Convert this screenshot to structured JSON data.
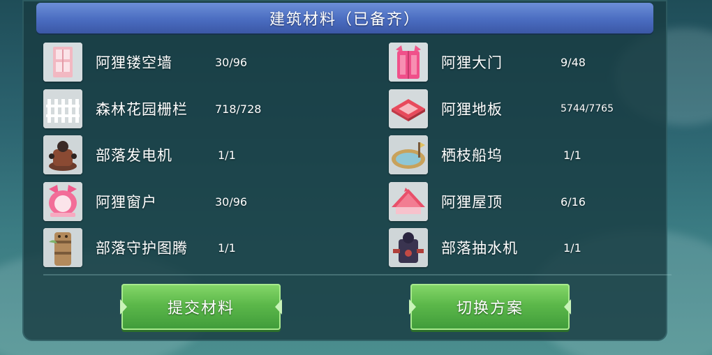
{
  "header": {
    "title": "建筑材料（已备齐）"
  },
  "left_items": [
    {
      "name": "阿狸镂空墙",
      "count": "30/96",
      "icon": "hollow-wall-icon"
    },
    {
      "name": "森林花园栅栏",
      "count": "718/728",
      "icon": "fence-icon"
    },
    {
      "name": "部落发电机",
      "count": "1/1",
      "icon": "generator-icon"
    },
    {
      "name": "阿狸窗户",
      "count": "30/96",
      "icon": "window-icon"
    },
    {
      "name": "部落守护图腾",
      "count": "1/1",
      "icon": "totem-icon"
    }
  ],
  "right_items": [
    {
      "name": "阿狸大门",
      "count": "9/48",
      "icon": "gate-icon"
    },
    {
      "name": "阿狸地板",
      "count": "5744/7765",
      "icon": "floor-icon"
    },
    {
      "name": "栖枝船坞",
      "count": "1/1",
      "icon": "dock-icon"
    },
    {
      "name": "阿狸屋顶",
      "count": "6/16",
      "icon": "roof-icon"
    },
    {
      "name": "部落抽水机",
      "count": "1/1",
      "icon": "water-pump-icon"
    }
  ],
  "buttons": {
    "submit_label": "提交材料",
    "switch_label": "切换方案"
  },
  "colors": {
    "title_bar": "#4a6cc0",
    "button_green": "#5cb84a",
    "panel": "#183c42"
  }
}
